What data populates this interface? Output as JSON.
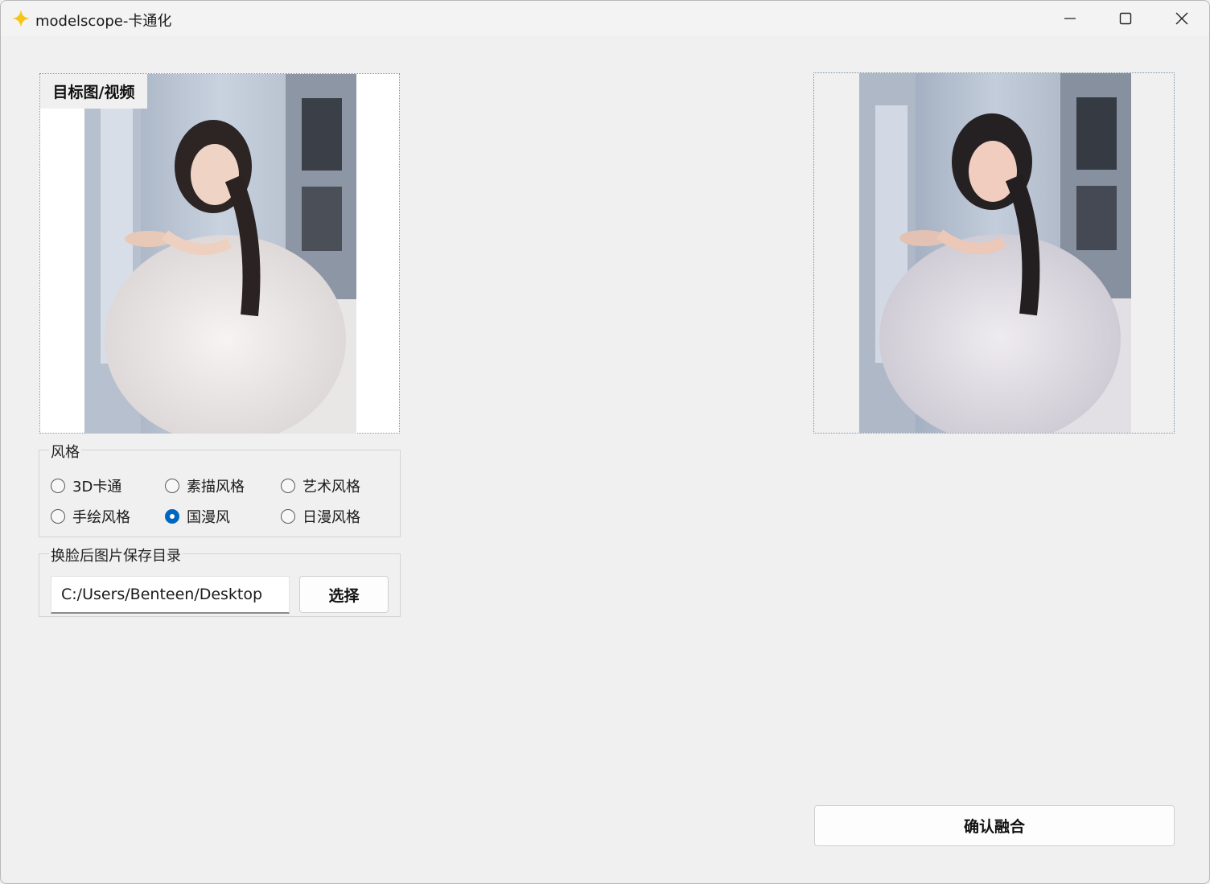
{
  "window": {
    "title": "modelscope-卡通化",
    "icon": "sparkle-icon",
    "controls": [
      "minimize-icon",
      "maximize-icon",
      "close-icon"
    ]
  },
  "target_panel": {
    "label": "目标图/视频"
  },
  "style_group": {
    "title": "风格",
    "options": [
      {
        "label": "3D卡通",
        "checked": false
      },
      {
        "label": "素描风格",
        "checked": false
      },
      {
        "label": "艺术风格",
        "checked": false
      },
      {
        "label": "手绘风格",
        "checked": false
      },
      {
        "label": "国漫风",
        "checked": true
      },
      {
        "label": "日漫风格",
        "checked": false
      }
    ]
  },
  "save_group": {
    "title": "换脸后图片保存目录",
    "path_value": "C:/Users/Benteen/Desktop",
    "select_button": "选择"
  },
  "confirm_button": "确认融合",
  "colors": {
    "background": "#f0f0f0",
    "accent": "#0067c0",
    "icon_yellow": "#f5c518"
  }
}
